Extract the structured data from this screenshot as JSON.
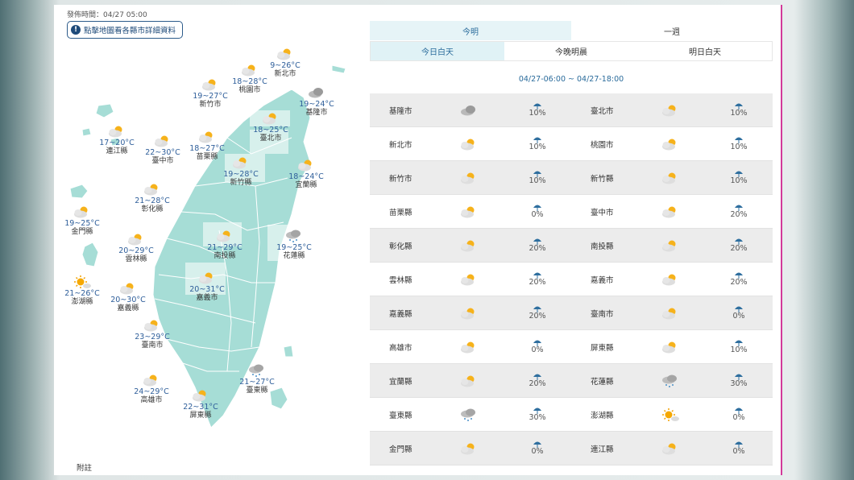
{
  "header": {
    "issue_time": "發佈時間：04/27 05:00",
    "notice": "點擊地圖看各縣市詳細資料",
    "footnote": "附註"
  },
  "tabs_period": [
    {
      "label": "今明",
      "active": true
    },
    {
      "label": "一週",
      "active": false
    }
  ],
  "tabs_time": [
    {
      "label": "今日白天",
      "active": true
    },
    {
      "label": "今晚明晨",
      "active": false
    },
    {
      "label": "明日白天",
      "active": false
    }
  ],
  "time_range": "04/27-06:00 ~ 04/27-18:00",
  "map_cities": [
    {
      "name": "桃園市",
      "temp": "18~28°C",
      "icon": "partly-cloudy-icon"
    },
    {
      "name": "新北市",
      "temp": "9~26°C",
      "icon": "partly-cloudy-icon"
    },
    {
      "name": "新竹市",
      "temp": "19~27°C",
      "icon": "partly-cloudy-icon"
    },
    {
      "name": "基隆市",
      "temp": "19~24°C",
      "icon": "cloudy-icon"
    },
    {
      "name": "臺北市",
      "temp": "18~25°C",
      "icon": "partly-cloudy-icon"
    },
    {
      "name": "連江縣",
      "temp": "17~20°C",
      "icon": "partly-cloudy-icon"
    },
    {
      "name": "臺中市",
      "temp": "22~30°C",
      "icon": "partly-cloudy-icon"
    },
    {
      "name": "苗栗縣",
      "temp": "18~27°C",
      "icon": "partly-cloudy-icon"
    },
    {
      "name": "新竹縣",
      "temp": "19~28°C",
      "icon": "partly-cloudy-icon"
    },
    {
      "name": "宜蘭縣",
      "temp": "18~24°C",
      "icon": "partly-cloudy-icon"
    },
    {
      "name": "彰化縣",
      "temp": "21~28°C",
      "icon": "partly-cloudy-icon"
    },
    {
      "name": "金門縣",
      "temp": "19~25°C",
      "icon": "partly-cloudy-icon"
    },
    {
      "name": "南投縣",
      "temp": "21~29°C",
      "icon": "partly-cloudy-icon"
    },
    {
      "name": "花蓮縣",
      "temp": "19~25°C",
      "icon": "rain-icon"
    },
    {
      "name": "雲林縣",
      "temp": "20~29°C",
      "icon": "partly-cloudy-icon"
    },
    {
      "name": "澎湖縣",
      "temp": "21~26°C",
      "icon": "sunny-icon"
    },
    {
      "name": "嘉義市",
      "temp": "20~31°C",
      "icon": "partly-cloudy-icon"
    },
    {
      "name": "嘉義縣",
      "temp": "20~30°C",
      "icon": "partly-cloudy-icon"
    },
    {
      "name": "臺南市",
      "temp": "23~29°C",
      "icon": "partly-cloudy-icon"
    },
    {
      "name": "臺東縣",
      "temp": "21~27°C",
      "icon": "rain-icon"
    },
    {
      "name": "高雄市",
      "temp": "24~29°C",
      "icon": "partly-cloudy-icon"
    },
    {
      "name": "屏東縣",
      "temp": "22~31°C",
      "icon": "partly-cloudy-icon"
    }
  ],
  "table_rows": [
    [
      {
        "name": "基隆市",
        "icon": "cloudy-icon",
        "rain": "10%"
      },
      {
        "name": "臺北市",
        "icon": "partly-cloudy-icon",
        "rain": "10%"
      }
    ],
    [
      {
        "name": "新北市",
        "icon": "partly-cloudy-icon",
        "rain": "10%"
      },
      {
        "name": "桃園市",
        "icon": "partly-cloudy-icon",
        "rain": "10%"
      }
    ],
    [
      {
        "name": "新竹市",
        "icon": "partly-cloudy-icon",
        "rain": "10%"
      },
      {
        "name": "新竹縣",
        "icon": "partly-cloudy-icon",
        "rain": "10%"
      }
    ],
    [
      {
        "name": "苗栗縣",
        "icon": "partly-cloudy-icon",
        "rain": "0%"
      },
      {
        "name": "臺中市",
        "icon": "partly-cloudy-icon",
        "rain": "20%"
      }
    ],
    [
      {
        "name": "彰化縣",
        "icon": "partly-cloudy-icon",
        "rain": "20%"
      },
      {
        "name": "南投縣",
        "icon": "partly-cloudy-icon",
        "rain": "20%"
      }
    ],
    [
      {
        "name": "雲林縣",
        "icon": "partly-cloudy-icon",
        "rain": "20%"
      },
      {
        "name": "嘉義市",
        "icon": "partly-cloudy-icon",
        "rain": "20%"
      }
    ],
    [
      {
        "name": "嘉義縣",
        "icon": "partly-cloudy-icon",
        "rain": "20%"
      },
      {
        "name": "臺南市",
        "icon": "partly-cloudy-icon",
        "rain": "0%"
      }
    ],
    [
      {
        "name": "高雄市",
        "icon": "partly-cloudy-icon",
        "rain": "0%"
      },
      {
        "name": "屏東縣",
        "icon": "partly-cloudy-icon",
        "rain": "10%"
      }
    ],
    [
      {
        "name": "宜蘭縣",
        "icon": "partly-cloudy-icon",
        "rain": "20%"
      },
      {
        "name": "花蓮縣",
        "icon": "rain-icon",
        "rain": "30%"
      }
    ],
    [
      {
        "name": "臺東縣",
        "icon": "rain-icon",
        "rain": "30%"
      },
      {
        "name": "澎湖縣",
        "icon": "sunny-icon",
        "rain": "0%"
      }
    ],
    [
      {
        "name": "金門縣",
        "icon": "partly-cloudy-icon",
        "rain": "0%"
      },
      {
        "name": "連江縣",
        "icon": "partly-cloudy-icon",
        "rain": "0%"
      }
    ]
  ],
  "colors": {
    "map_fill": "#a6ddd6",
    "temp_text": "#2e5e9a",
    "accent": "#2a6b9b",
    "active_tab": "#e6f4f7",
    "row_shade": "#ececec",
    "rain_icon": "#2f6f9f",
    "border_accent": "#d23a9a"
  }
}
